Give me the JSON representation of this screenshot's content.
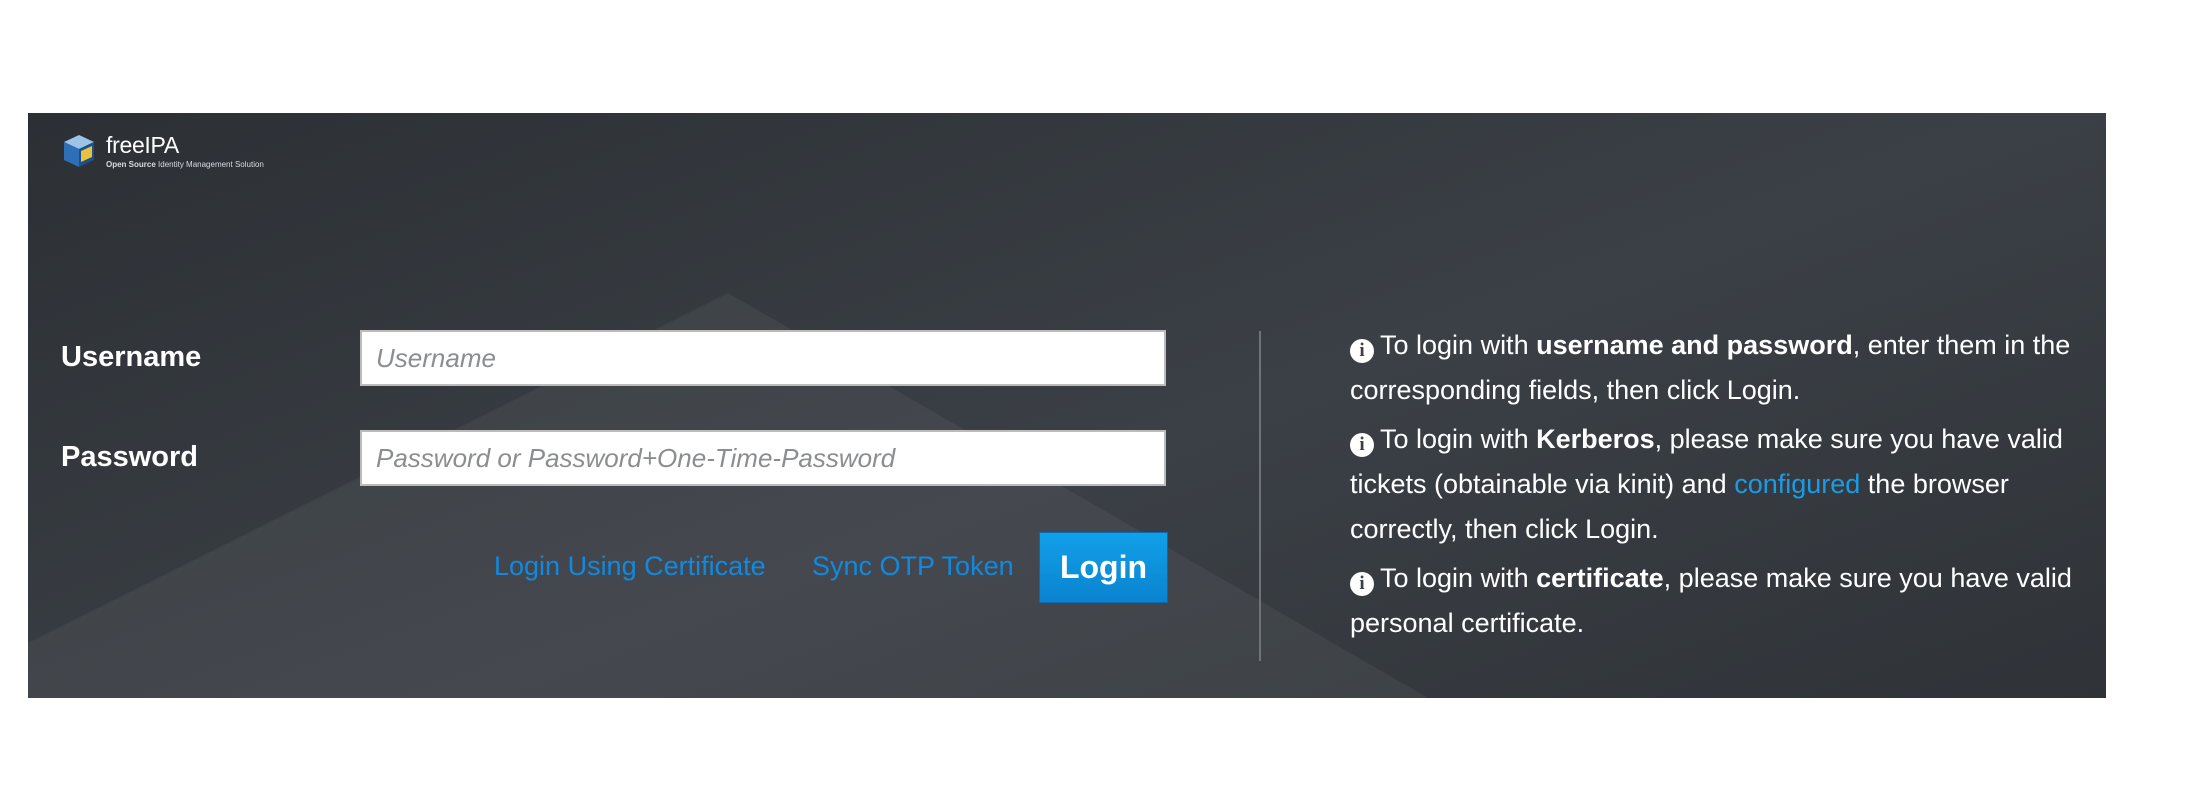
{
  "brand": {
    "name": "freeIPA",
    "tagline_bold": "Open Source",
    "tagline_rest": " Identity Management Solution"
  },
  "form": {
    "username_label": "Username",
    "username_placeholder": "Username",
    "username_value": "",
    "password_label": "Password",
    "password_placeholder": "Password or Password+One-Time-Password",
    "password_value": "",
    "cert_link": "Login Using Certificate",
    "otp_link": "Sync OTP Token",
    "login_button": "Login"
  },
  "help": {
    "item1": {
      "icon": "info-circle-icon",
      "prefix": "To login with ",
      "bold": "username and password",
      "suffix": ", enter them in the corresponding fields, then click Login."
    },
    "item2": {
      "icon": "info-circle-icon",
      "prefix": "To login with ",
      "bold": "Kerberos",
      "middle": ", please make sure you have valid tickets (obtainable via kinit) and ",
      "link": "configured",
      "suffix": " the browser correctly, then click Login."
    },
    "item3": {
      "icon": "info-circle-icon",
      "prefix": "To login with ",
      "bold": "certificate",
      "suffix": ", please make sure you have valid personal certificate."
    }
  },
  "colors": {
    "panel_bg": "#363a3f",
    "link": "#0f8ae0",
    "button": "#0a8ad6"
  }
}
